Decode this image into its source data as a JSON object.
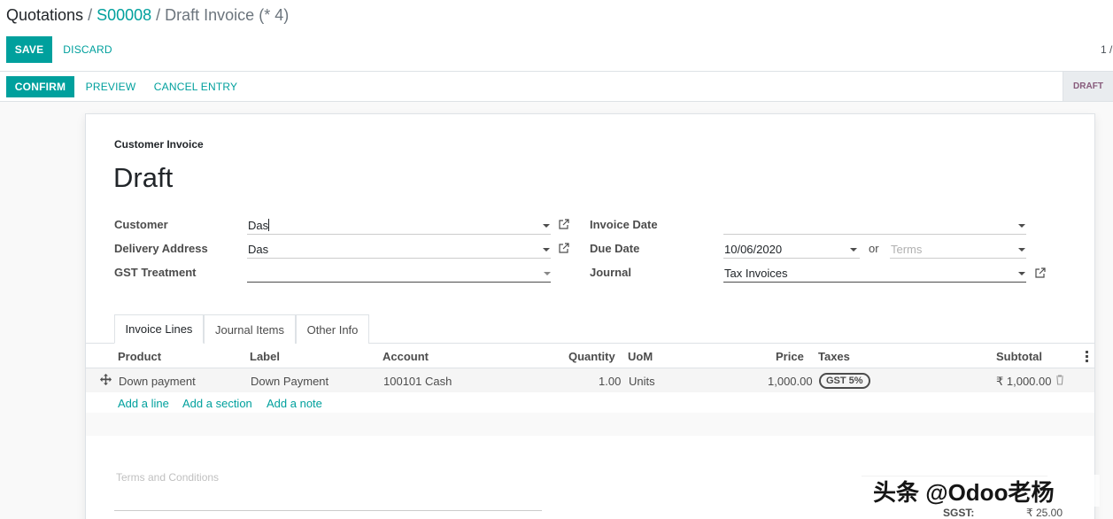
{
  "breadcrumb": {
    "root": "Quotations",
    "order": "S00008",
    "current": "Draft Invoice (* 4)",
    "separator": "/"
  },
  "buttons": {
    "save": "SAVE",
    "discard": "DISCARD",
    "confirm": "CONFIRM",
    "preview": "PREVIEW",
    "cancel_entry": "CANCEL ENTRY"
  },
  "pager": "1 /",
  "status": "DRAFT",
  "sheet": {
    "doc_type": "Customer Invoice",
    "title": "Draft",
    "fields": {
      "customer": {
        "label": "Customer",
        "value": "Das"
      },
      "delivery_address": {
        "label": "Delivery Address",
        "value": "Das"
      },
      "gst_treatment": {
        "label": "GST Treatment",
        "value": ""
      },
      "invoice_date": {
        "label": "Invoice Date",
        "value": ""
      },
      "due_date": {
        "label": "Due Date",
        "value": "10/06/2020",
        "or": "or",
        "terms_placeholder": "Terms"
      },
      "journal": {
        "label": "Journal",
        "value": "Tax Invoices"
      }
    },
    "tabs": [
      "Invoice Lines",
      "Journal Items",
      "Other Info"
    ],
    "columns": {
      "product": "Product",
      "label": "Label",
      "account": "Account",
      "quantity": "Quantity",
      "uom": "UoM",
      "price": "Price",
      "taxes": "Taxes",
      "subtotal": "Subtotal"
    },
    "lines": [
      {
        "product": "Down payment",
        "label": "Down Payment",
        "account": "100101 Cash",
        "quantity": "1.00",
        "uom": "Units",
        "price": "1,000.00",
        "tax": "GST 5%",
        "subtotal": "₹ 1,000.00"
      }
    ],
    "add_links": {
      "line": "Add a line",
      "section": "Add a section",
      "note": "Add a note"
    },
    "terms_placeholder": "Terms and Conditions",
    "totals": {
      "sgst_label": "SGST:",
      "sgst_value": "₹ 25.00"
    }
  },
  "watermark": "头条 @Odoo老杨"
}
